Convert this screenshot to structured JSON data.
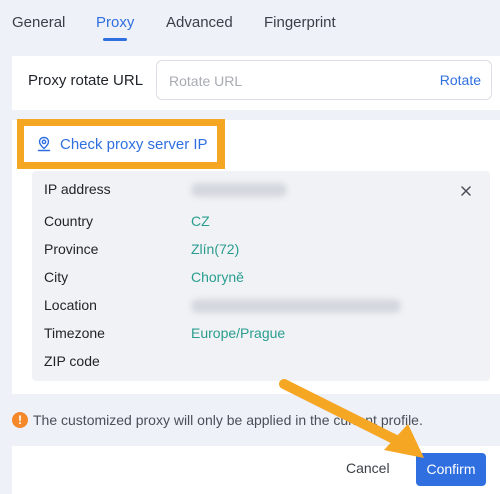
{
  "tabs": [
    {
      "label": "General"
    },
    {
      "label": "Proxy",
      "active": true
    },
    {
      "label": "Advanced"
    },
    {
      "label": "Fingerprint"
    }
  ],
  "proxy_rotate": {
    "label": "Proxy rotate URL",
    "placeholder": "Rotate URL",
    "value": "",
    "button": "Rotate"
  },
  "check_button": {
    "label": "Check proxy server IP",
    "icon": "location-pin-icon"
  },
  "ip_info": {
    "rows": [
      {
        "label": "IP address",
        "value": ""
      },
      {
        "label": "Country",
        "value": "CZ"
      },
      {
        "label": "Province",
        "value": "Zlín(72)"
      },
      {
        "label": "City",
        "value": "Choryně"
      },
      {
        "label": "Location",
        "value": ""
      },
      {
        "label": "Timezone",
        "value": "Europe/Prague"
      },
      {
        "label": "ZIP code",
        "value": ""
      }
    ],
    "close_icon": "close-icon"
  },
  "notice": {
    "icon": "exclamation-icon",
    "text": "The customized proxy will only be applied in the current profile."
  },
  "footer": {
    "cancel_label": "Cancel",
    "confirm_label": "Confirm"
  },
  "colors": {
    "accent": "#2f6fe0",
    "value_text": "#2a9d8f",
    "highlight": "#f5a623",
    "warning": "#f4882b"
  }
}
